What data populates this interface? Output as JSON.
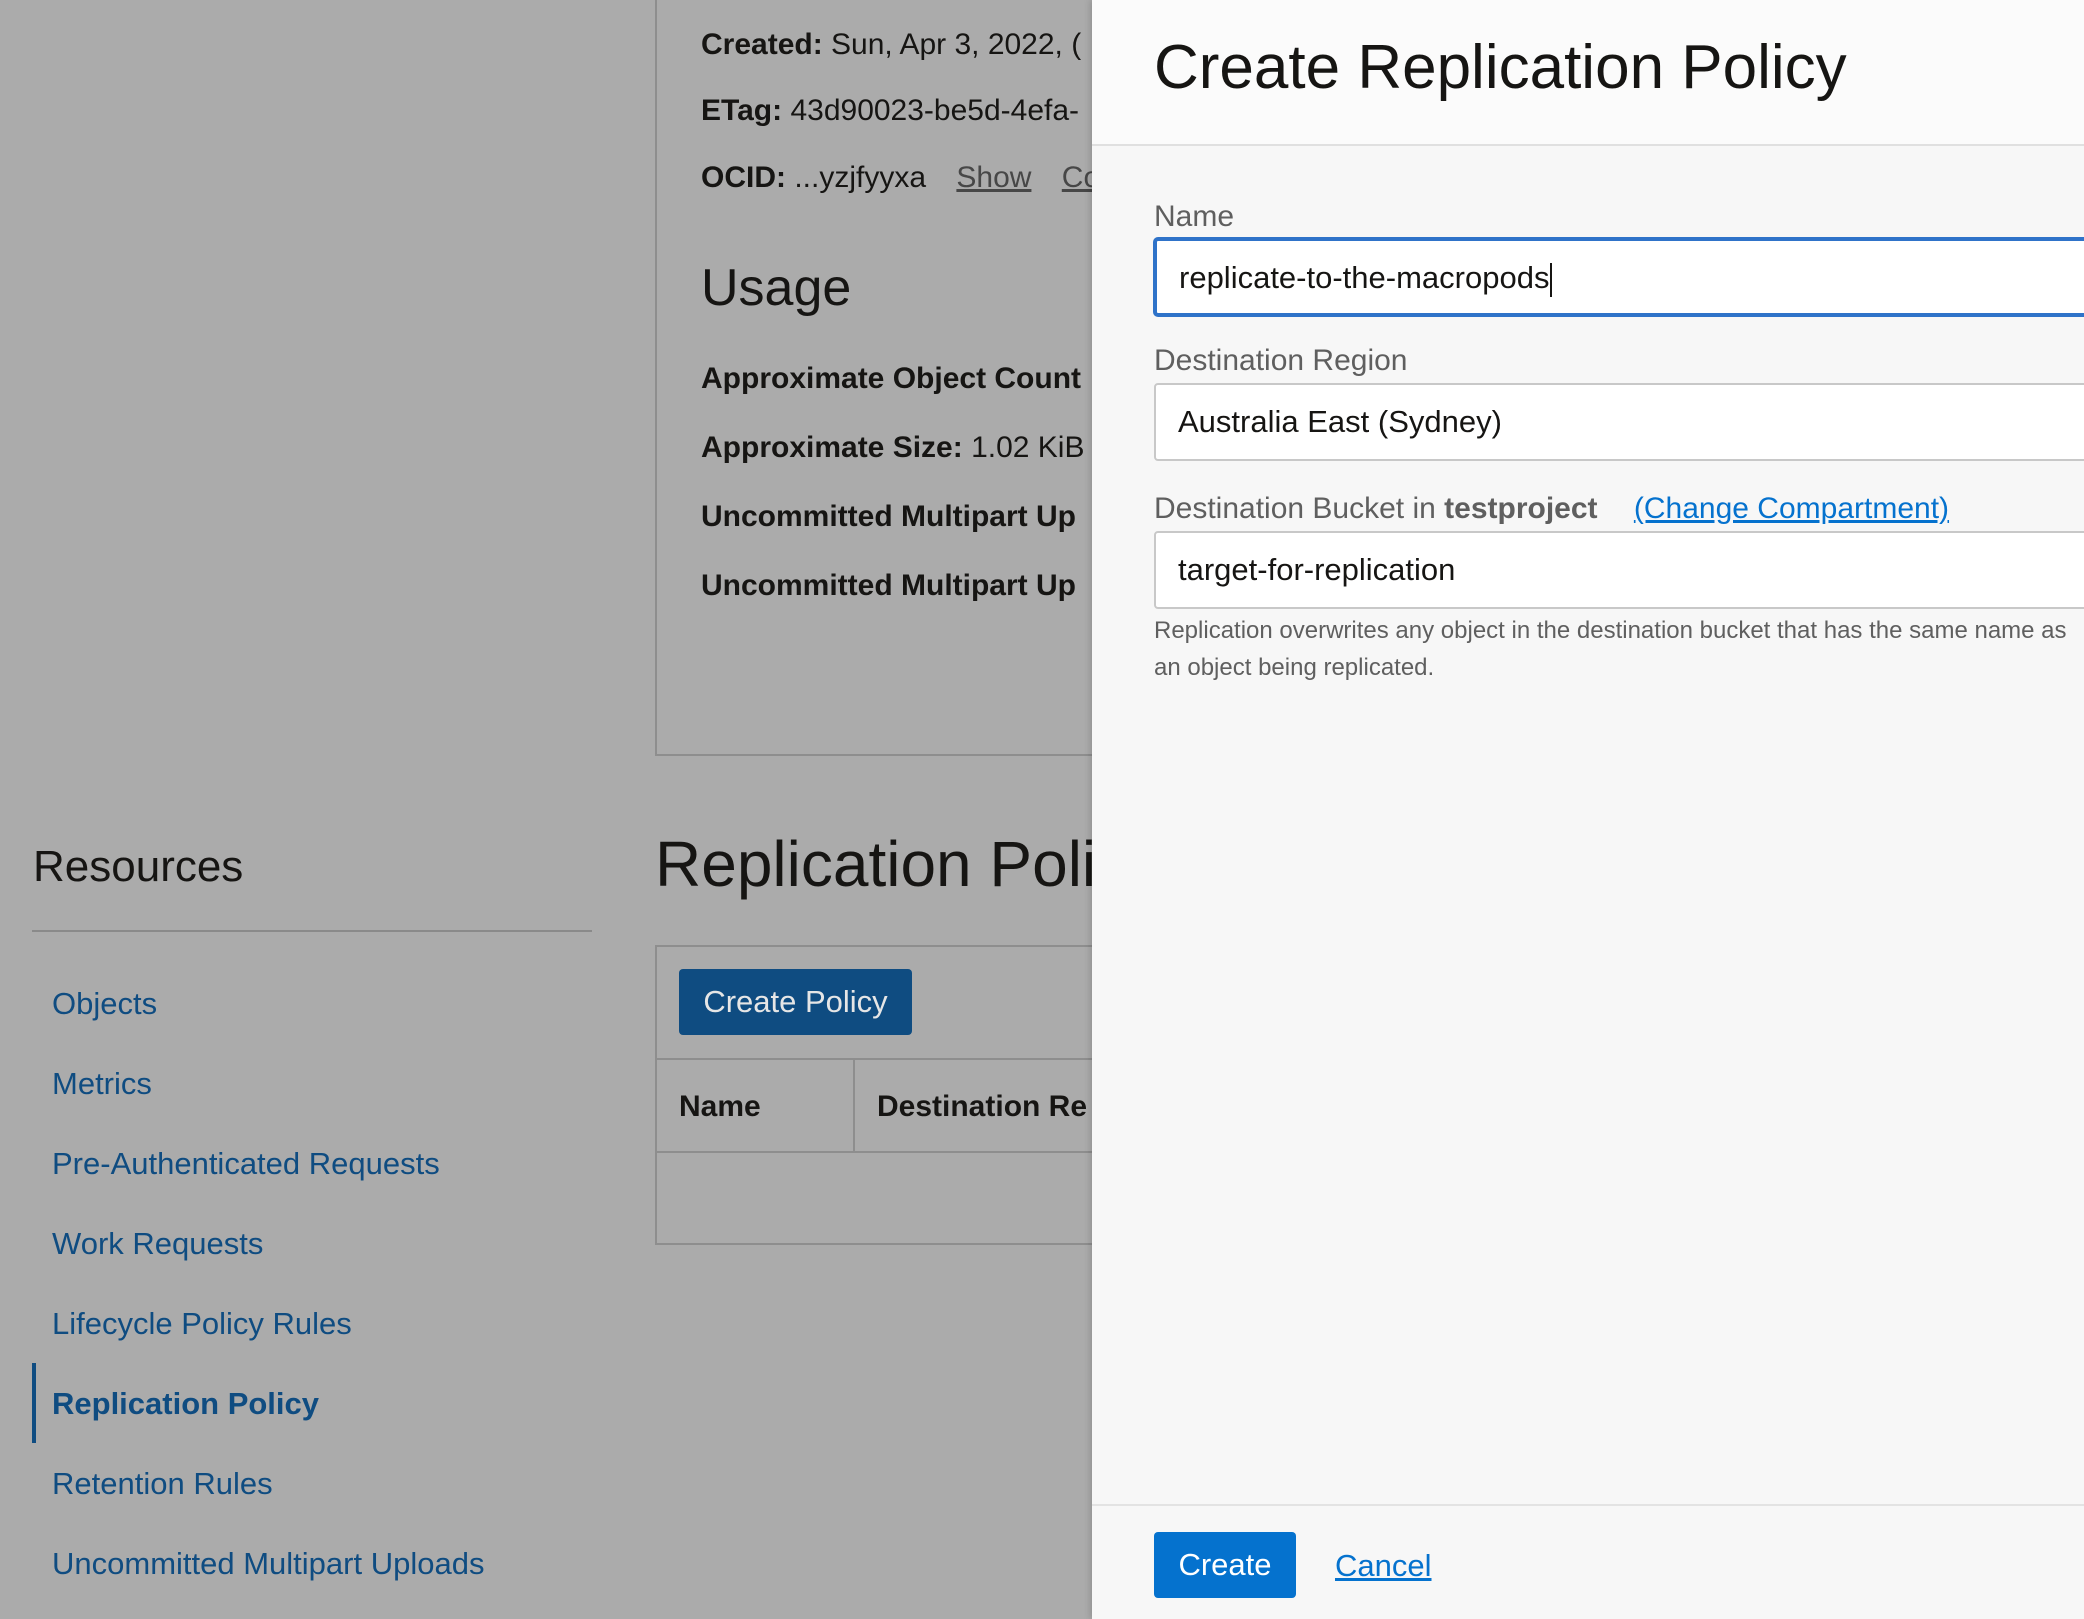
{
  "background": {
    "details": {
      "created_label": "Created:",
      "created_value": "Sun, Apr 3, 2022, (",
      "etag_label": "ETag:",
      "etag_value": "43d90023-be5d-4efa-",
      "ocid_label": "OCID:",
      "ocid_value": "...yzjfyyxa",
      "show_link": "Show",
      "copy_link": "Co"
    },
    "usage": {
      "title": "Usage",
      "rows": [
        {
          "label": "Approximate Object Count",
          "value": ""
        },
        {
          "label": "Approximate Size:",
          "value": "1.02 KiB"
        },
        {
          "label": "Uncommitted Multipart Up",
          "value": ""
        },
        {
          "label": "Uncommitted Multipart Up",
          "value": ""
        }
      ]
    },
    "resources": {
      "title": "Resources",
      "items": [
        {
          "label": "Objects"
        },
        {
          "label": "Metrics"
        },
        {
          "label": "Pre-Authenticated Requests"
        },
        {
          "label": "Work Requests"
        },
        {
          "label": "Lifecycle Policy Rules"
        },
        {
          "label": "Replication Policy"
        },
        {
          "label": "Retention Rules"
        },
        {
          "label": "Uncommitted Multipart Uploads"
        }
      ],
      "active_item": "Replication Policy"
    },
    "section": {
      "title": "Replication Policies",
      "create_button": "Create Policy",
      "columns": [
        "Name",
        "Destination Re"
      ]
    }
  },
  "drawer": {
    "title": "Create Replication Policy",
    "name_label": "Name",
    "name_value": "replicate-to-the-macropods",
    "region_label": "Destination Region",
    "region_value": "Australia East (Sydney)",
    "bucket_label_prefix": "Destination Bucket in",
    "bucket_compartment": "testproject",
    "change_compartment_link": "(Change Compartment)",
    "bucket_value": "target-for-replication",
    "help_text": "Replication overwrites any object in the destination bucket that has the same name as an object being replicated.",
    "create_button": "Create",
    "cancel_link": "Cancel"
  },
  "colors": {
    "overlay": "#ababab",
    "primary_button": "#0572ce",
    "dim_button": "#0f4c81",
    "link": "#0572ce",
    "focus_border": "#2f73c9"
  }
}
